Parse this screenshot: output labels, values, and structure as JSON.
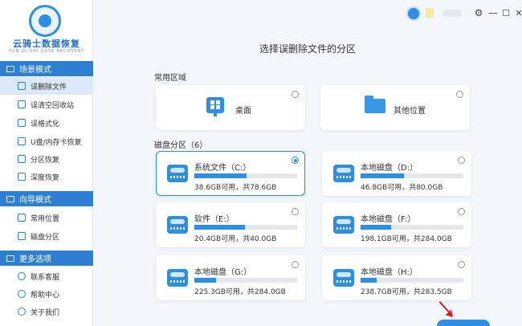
{
  "app": {
    "logo_title": "云骑士数据恢复",
    "logo_subtitle": "YUN QI SHI DATA RECOVERY"
  },
  "window_controls": {
    "settings": "⚙",
    "minimize": "—",
    "maximize": "☐",
    "close": "✕"
  },
  "sidebar": {
    "sections": [
      {
        "label": "场景模式",
        "items": [
          {
            "label": "误删除文件",
            "active": true
          },
          {
            "label": "误清空回收站"
          },
          {
            "label": "误格式化"
          },
          {
            "label": "U盘/内存卡恢复"
          },
          {
            "label": "分区恢复"
          },
          {
            "label": "深度恢复"
          }
        ]
      },
      {
        "label": "向导模式",
        "items": [
          {
            "label": "常用位置"
          },
          {
            "label": "磁盘分区"
          }
        ]
      },
      {
        "label": "更多选项",
        "items": [
          {
            "label": "联系客服"
          },
          {
            "label": "帮助中心"
          },
          {
            "label": "关于我们"
          }
        ]
      }
    ]
  },
  "main": {
    "title": "选择误删除文件的分区",
    "common_area_label": "常用区域",
    "common_areas": [
      {
        "label": "桌面",
        "icon": "windows-desktop-icon"
      },
      {
        "label": "其他位置",
        "icon": "folder-icon"
      }
    ],
    "partition_label": "磁盘分区（6）",
    "partitions": [
      {
        "name": "系统文件（C:）",
        "info": "38.6GB可用，共78.6GB",
        "used_fraction": 0.51,
        "selected": true
      },
      {
        "name": "本地磁盘（D:）",
        "info": "46.8GB可用，共80.0GB",
        "used_fraction": 0.42
      },
      {
        "name": "软件（E:）",
        "info": "20.4GB可用，共40.0GB",
        "used_fraction": 0.49
      },
      {
        "name": "本地磁盘（F:）",
        "info": "198.1GB可用，共284.0GB",
        "used_fraction": 0.3
      },
      {
        "name": "本地磁盘（G:）",
        "info": "225.3GB可用，共284.0GB",
        "used_fraction": 0.21
      },
      {
        "name": "本地磁盘（H:）",
        "info": "238.7GB可用，共283.5GB",
        "used_fraction": 0.16
      }
    ]
  },
  "colors": {
    "accent": "#2e8ee0",
    "sidebar_header": "#2d7fd3",
    "active_item": "#dbe9f8",
    "arrow": "#e02020"
  }
}
